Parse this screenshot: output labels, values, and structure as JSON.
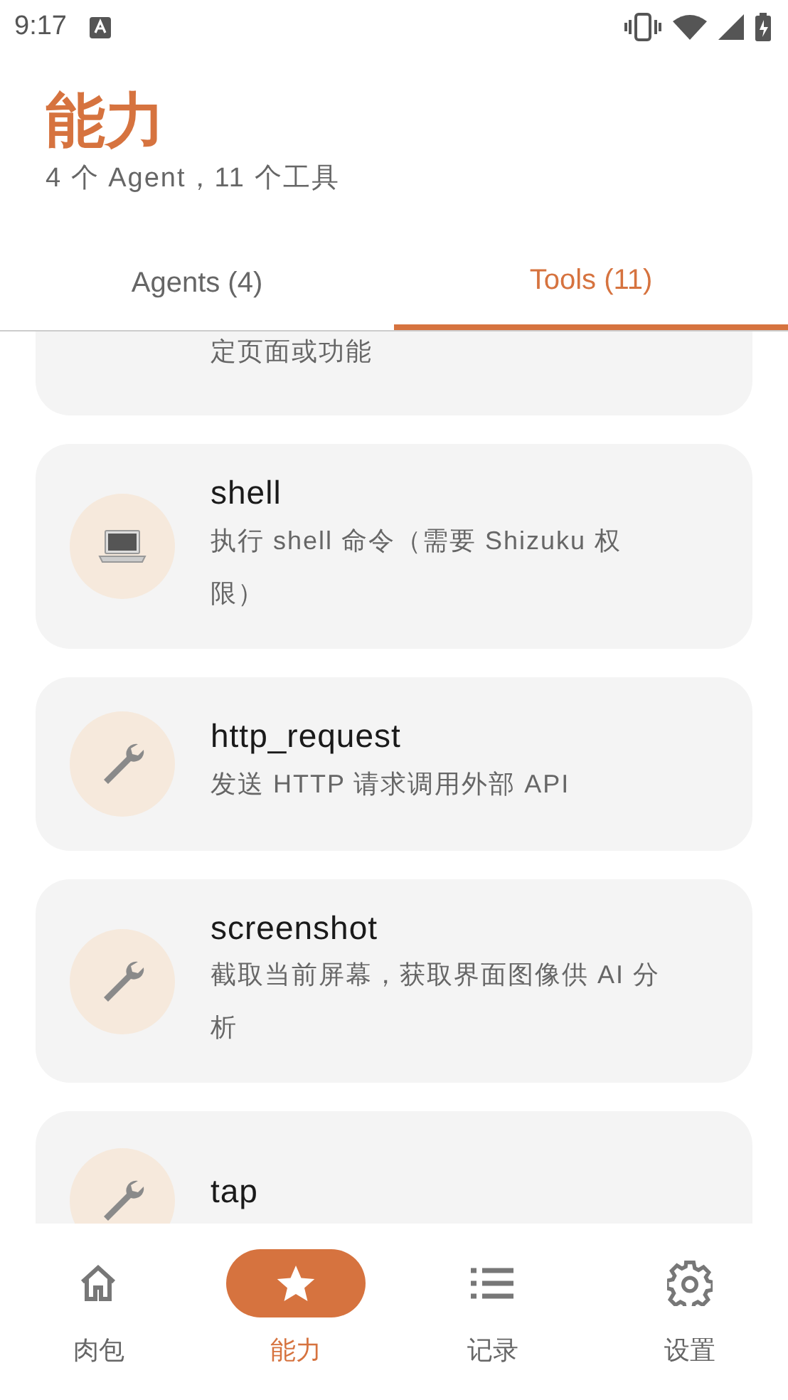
{
  "status_bar": {
    "time": "9:17"
  },
  "header": {
    "title": "能力",
    "subtitle": "4 个 Agent，11 个工具"
  },
  "tabs": [
    {
      "label": "Agents (4)",
      "selected": false
    },
    {
      "label": "Tools (11)",
      "selected": true
    }
  ],
  "tools": [
    {
      "kind": "clipped",
      "description": "定页面或功能"
    },
    {
      "kind": "full",
      "name": "shell",
      "description": "执行 shell 命令（需要 Shizuku 权限）"
    },
    {
      "kind": "full",
      "name": "http_request",
      "description": "发送 HTTP 请求调用外部 API"
    },
    {
      "kind": "full",
      "name": "screenshot",
      "description": "截取当前屏幕，获取界面图像供 AI 分析"
    },
    {
      "kind": "title_only",
      "name": "tap"
    }
  ],
  "bottom_nav": [
    {
      "label": "肉包",
      "selected": false
    },
    {
      "label": "能力",
      "selected": true
    },
    {
      "label": "记录",
      "selected": false
    },
    {
      "label": "设置",
      "selected": false
    }
  ]
}
